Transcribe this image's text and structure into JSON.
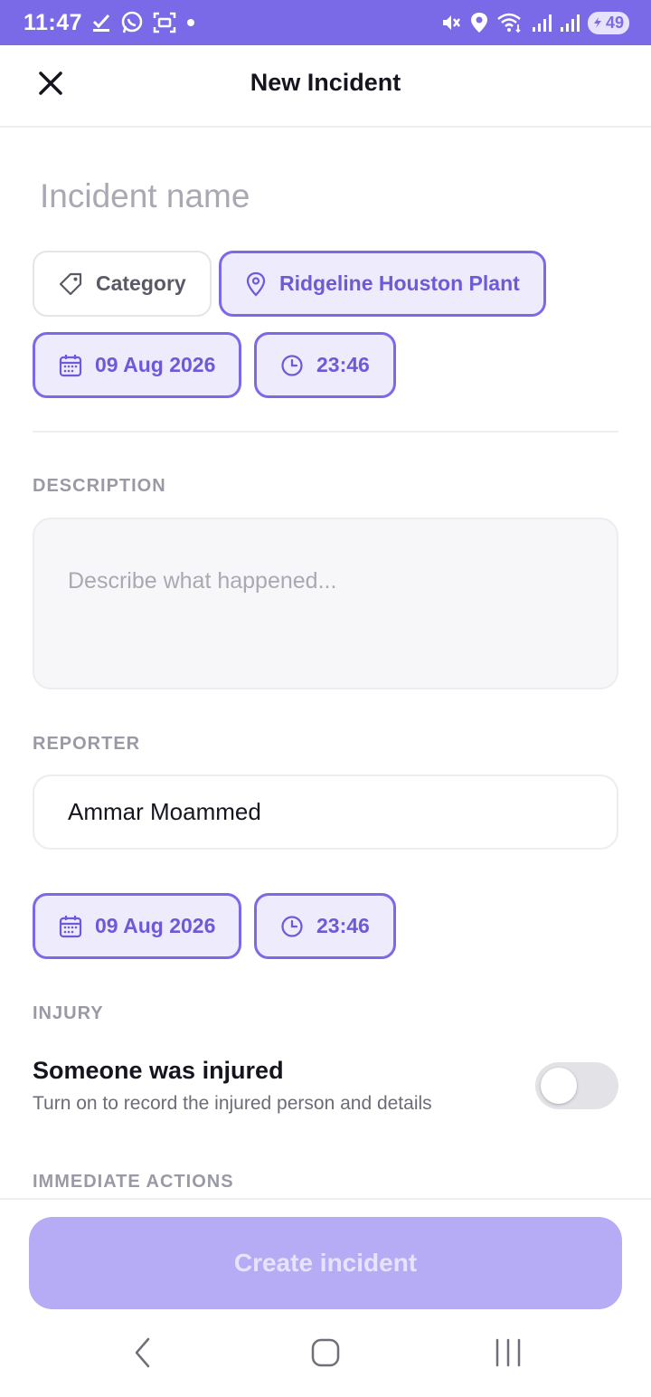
{
  "status_bar": {
    "time": "11:47",
    "battery": "49",
    "left_icons": [
      "download-done-icon",
      "whatsapp-icon",
      "screenshot-icon",
      "dot-icon"
    ],
    "right_icons": [
      "mute-icon",
      "location-icon",
      "wifi-icon",
      "signal-icon",
      "signal-icon",
      "battery-icon"
    ]
  },
  "header": {
    "title": "New Incident"
  },
  "form": {
    "incident_name_placeholder": "Incident name",
    "category_label": "Category",
    "location_label": "Ridgeline Houston Plant",
    "date": "09 Aug 2026",
    "time": "23:46",
    "description": {
      "label": "DESCRIPTION",
      "placeholder": "Describe what happened..."
    },
    "reporter": {
      "label": "REPORTER",
      "value": "Ammar Moammed",
      "date": "09 Aug 2026",
      "time": "23:46"
    },
    "injury": {
      "label": "INJURY",
      "title": "Someone was injured",
      "subtitle": "Turn on to record the injured person and details",
      "toggle_on": false
    },
    "immediate_actions_label": "IMMEDIATE ACTIONS"
  },
  "actions": {
    "create_label": "Create incident"
  },
  "colors": {
    "accent": "#7b6ae8",
    "accent_light": "#eeebfc",
    "button_disabled": "#b6acf5"
  }
}
